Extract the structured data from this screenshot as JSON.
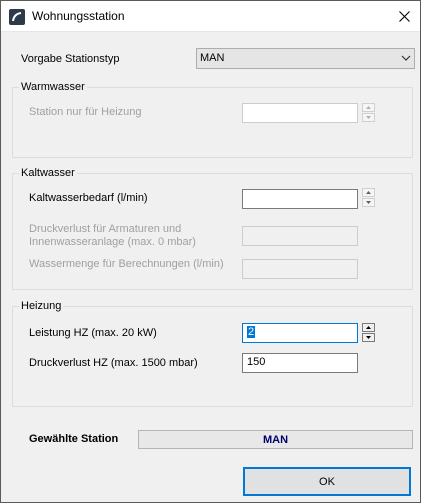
{
  "window": {
    "title": "Wohnungsstation"
  },
  "vorgabe": {
    "label": "Vorgabe Stationstyp",
    "value": "MAN"
  },
  "warmwasser": {
    "title": "Warmwasser",
    "station_label": "Station nur für Heizung",
    "station_value": ""
  },
  "kaltwasser": {
    "title": "Kaltwasser",
    "bedarf_label": "Kaltwasserbedarf (l/min)",
    "bedarf_value": "",
    "druckverlust_label_line1": "Druckverlust für Armaturen und",
    "druckverlust_label_line2": "Innenwasseranlage (max. 0 mbar)",
    "druckverlust_value": "",
    "wassermenge_label": "Wassermenge für Berechnungen (l/min)",
    "wassermenge_value": ""
  },
  "heizung": {
    "title": "Heizung",
    "leistung_label": "Leistung HZ (max. 20 kW)",
    "leistung_value": "2",
    "druckverlust_label": "Druckverlust HZ (max. 1500 mbar)",
    "druckverlust_value": "150"
  },
  "status": {
    "label": "Gewählte Station",
    "value": "MAN"
  },
  "buttons": {
    "ok": "OK"
  },
  "colors": {
    "focus": "#0078d7",
    "status_text": "#00006e"
  }
}
